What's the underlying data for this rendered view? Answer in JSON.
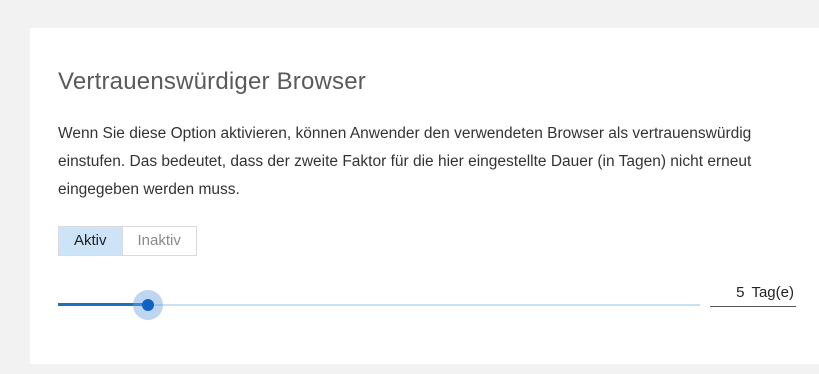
{
  "section": {
    "title": "Vertrauenswürdiger Browser",
    "description": "Wenn Sie diese Option aktivieren, können Anwender den verwendeten Browser als vertrauenswürdig einstufen. Das bedeutet, dass der zweite Faktor für die hier eingestellte Dauer (in Tagen) nicht erneut eingegeben werden muss."
  },
  "toggle": {
    "active_label": "Aktiv",
    "inactive_label": "Inaktiv",
    "selected": "Aktiv"
  },
  "duration": {
    "value": "5",
    "unit": "Tag(e)",
    "slider_fraction": 0.14
  },
  "colors": {
    "accent": "#0f62c4",
    "track": "#c9dff2",
    "toggle_active_bg": "#cde3f8"
  }
}
